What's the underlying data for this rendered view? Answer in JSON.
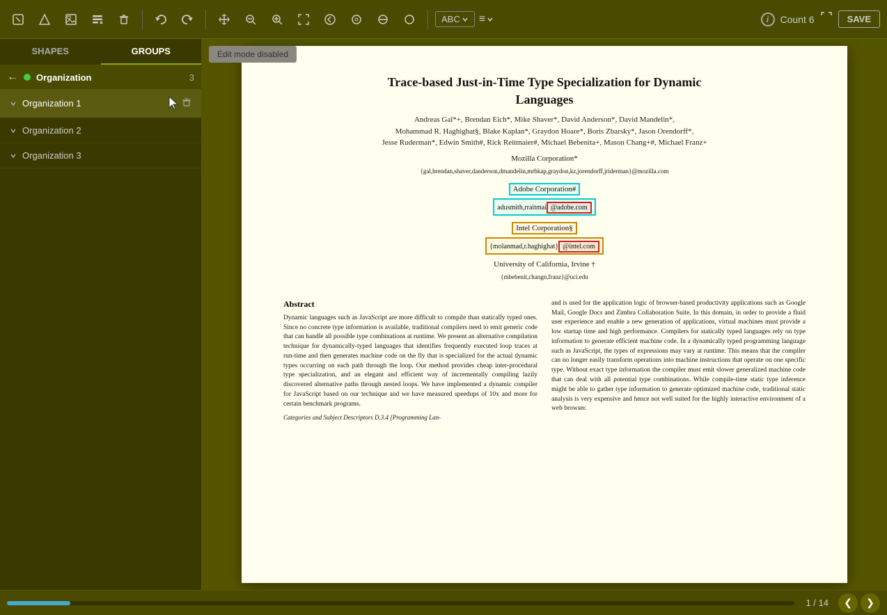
{
  "toolbar": {
    "tools": [
      {
        "name": "select-tool",
        "icon": "⬜",
        "label": "Select"
      },
      {
        "name": "shape-tool",
        "icon": "△",
        "label": "Shape"
      },
      {
        "name": "image-tool",
        "icon": "▣",
        "label": "Image"
      },
      {
        "name": "edit-tool",
        "icon": "✎",
        "label": "Edit"
      },
      {
        "name": "delete-tool",
        "icon": "🗑",
        "label": "Delete"
      },
      {
        "name": "undo-tool",
        "icon": "↩",
        "label": "Undo"
      },
      {
        "name": "redo-tool",
        "icon": "↪",
        "label": "Redo"
      }
    ],
    "view_tools": [
      {
        "name": "move-tool",
        "icon": "✛",
        "label": "Move"
      },
      {
        "name": "zoom-out-tool",
        "icon": "⊖",
        "label": "Zoom Out"
      },
      {
        "name": "zoom-in-tool",
        "icon": "⊕",
        "label": "Zoom In"
      },
      {
        "name": "fit-tool",
        "icon": "⤢",
        "label": "Fit"
      },
      {
        "name": "prev-tool",
        "icon": "⬆",
        "label": "Previous"
      },
      {
        "name": "circle-tool",
        "icon": "◎",
        "label": "Circle"
      },
      {
        "name": "clear-tool",
        "icon": "⌀",
        "label": "Clear"
      },
      {
        "name": "brush-tool",
        "icon": "◑",
        "label": "Brush"
      }
    ],
    "abc_label": "ABC",
    "hamburger_label": "≡",
    "count_label": "Count 6",
    "save_label": "SAVE"
  },
  "sidebar": {
    "tab_shapes": "SHAPES",
    "tab_groups": "GROUPS",
    "active_tab": "GROUPS",
    "back_label": "←",
    "header": {
      "dot_color": "#44cc44",
      "label": "Organization",
      "count": "3"
    },
    "groups": [
      {
        "id": 1,
        "label": "Organization 1",
        "selected": true
      },
      {
        "id": 2,
        "label": "Organization 2",
        "selected": false
      },
      {
        "id": 3,
        "label": "Organization 3",
        "selected": false
      }
    ],
    "delete_icon": "🗑"
  },
  "edit_mode_bar": {
    "text": "Edit mode disabled"
  },
  "document": {
    "title_line1": "Trace-based Just-in-Time Type Specialization for Dynamic",
    "title_line2": "Languages",
    "authors_line1": "Andreas Gal*+, Brendan Eich*, Mike Shaver*, David Anderson*, David Mandelin*,",
    "authors_line2": "Mohammad R. Haghighat§, Blake Kaplan*, Graydon Hoare*, Boris Zbarsky*, Jason Orendorff*,",
    "authors_line3": "Jesse Ruderman*, Edwin Smith#, Rick Reitmaier#, Michael Bebenita+, Mason Chang+#, Michael Franz+",
    "org1_name": "Mozilla Corporation*",
    "org1_email": "{gal,brendan,shaver,danderson,dmandelin,mrbkap,graydon,kz,jorendorff,jriderman}@mozilla.com",
    "org2_name": "Adobe Corporation#",
    "org2_email_left": "adusmith,rraitmai",
    "org2_email_right": "@adobe.com",
    "org3_name": "Intel Corporation§",
    "org3_email_left": "{molanmad,r.haghighat}",
    "org3_email_right": "@intel.com",
    "org4_name": "University of California, Irvine †",
    "org4_email": "{mbebenit,changn,franz}@uci.edu",
    "abstract_title": "Abstract",
    "abstract_left": "Dynamic languages such as JavaScript are more difficult to compile than statically typed ones. Since no concrete type information is available, traditional compilers need to emit generic code that can handle all possible type combinations at runtime. We present an alternative compilation technique for dynamically-typed languages that identifies frequently executed loop traces at run-time and then generates machine code on the fly that is specialized for the actual dynamic types occurring on each path through the loop. Our method provides cheap inter-procedural type specialization, and an elegant and efficient way of incrementally compiling lazily discovered alternative paths through nested loops. We have implemented a dynamic compiler for JavaScript based on our technique and we have measured speedups of 10x and more for certain benchmark programs.",
    "abstract_right": "and is used for the application logic of browser-based productivity applications such as Google Mail, Google Docs and Zimbra Collaboration Suite. In this domain, in order to provide a fluid user experience and enable a new generation of applications, virtual machines must provide a low startup time and high performance.\n\n    Compilers for statically typed languages rely on type information to generate efficient machine code. In a dynamically typed programming language such as JavaScript, the types of expressions may vary at runtime. This means that the compiler can no longer easily transform operations into machine instructions that operate on one specific type. Without exact type information the compiler must emit slower generalized machine code that can deal with all potential type combinations. While compile-time static type inference might be able to gather type information to generate optimized machine code, traditional static analysis is very expensive and hence not well suited for the highly interactive environment of a web browser.",
    "categories_text": "Categories and Subject Descriptors   D.3.4 [Programming Lan-"
  },
  "bottom": {
    "progress_percent": 8,
    "page_current": 1,
    "page_total": 14,
    "page_display": "1 / 14",
    "prev_icon": "❮",
    "next_icon": "❯"
  }
}
